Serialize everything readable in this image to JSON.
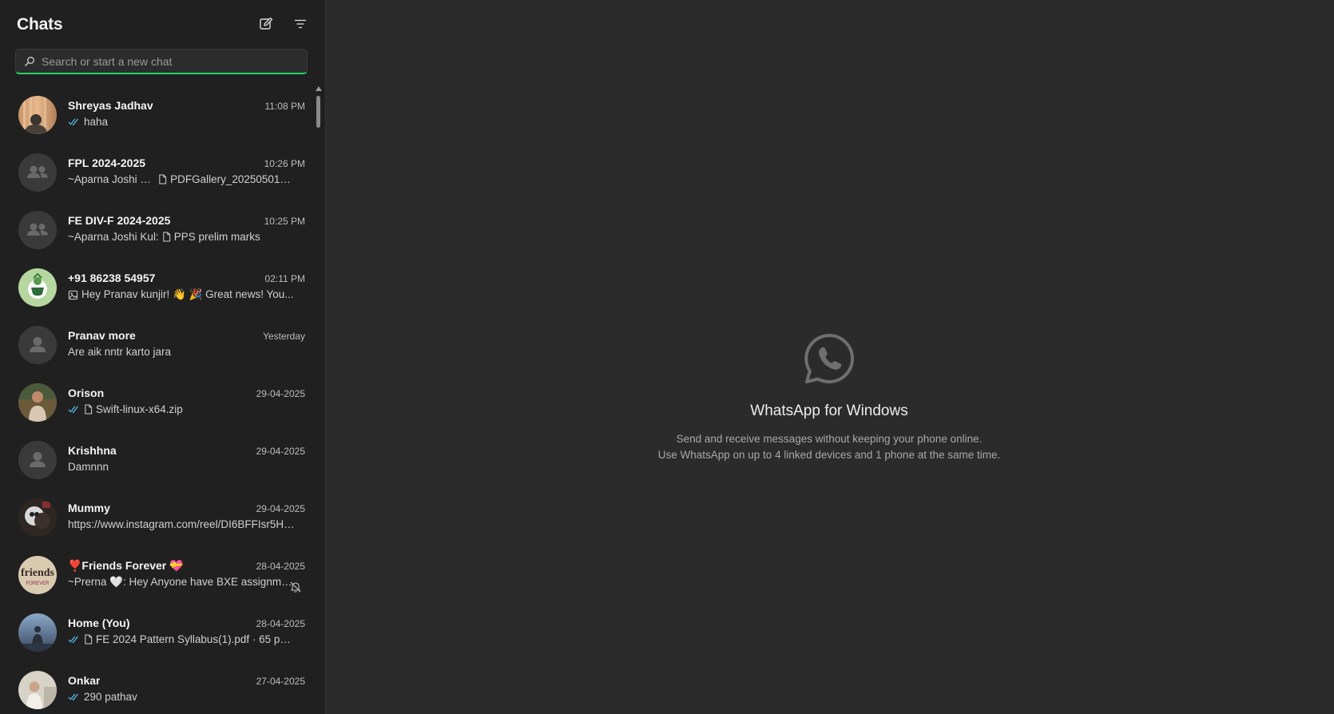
{
  "sidebar": {
    "title": "Chats",
    "search_placeholder": "Search or start a new chat"
  },
  "chats": [
    {
      "name": "Shreyas Jadhav",
      "time": "11:08 PM",
      "preview": "haha",
      "ticks": true,
      "doc": false,
      "img": false,
      "avatar": "photo-warm"
    },
    {
      "name": "FPL 2024-2025",
      "time": "10:26 PM",
      "preview": "~Aparna Joshi Kul: ",
      "doc_name": "PDFGallery_20250501_2...",
      "doc": true,
      "avatar": "group"
    },
    {
      "name": "FE DIV-F  2024-2025",
      "time": "10:25 PM",
      "preview": "~Aparna Joshi Kul: ",
      "doc_name": "PPS prelim marks",
      "doc": true,
      "avatar": "group"
    },
    {
      "name": "+91 86238 54957",
      "time": "02:11 PM",
      "preview": "Hey Pranav kunjir! 👋  🎉 Great news! You...",
      "img": true,
      "avatar": "photo-green"
    },
    {
      "name": "Pranav more",
      "time": "Yesterday",
      "preview": "Are aik nntr karto jara",
      "avatar": "person"
    },
    {
      "name": "Orison",
      "time": "29-04-2025",
      "preview": "",
      "doc_name": "Swift-linux-x64.zip",
      "ticks": true,
      "doc": true,
      "avatar": "photo-person"
    },
    {
      "name": "Krishhna",
      "time": "29-04-2025",
      "preview": "Damnnn",
      "avatar": "person"
    },
    {
      "name": "Mummy",
      "time": "29-04-2025",
      "preview": "https://www.instagram.com/reel/DI6BFFIsr5H/?...",
      "avatar": "photo-dark"
    },
    {
      "name": "❣️Friends Forever 💝",
      "time": "28-04-2025",
      "preview": "~Prerna 🤍: Hey Anyone have BXE assignme...",
      "muted": true,
      "avatar": "photo-friends"
    },
    {
      "name": "Home (You)",
      "time": "28-04-2025",
      "preview": "",
      "doc_name": "FE 2024 Pattern Syllabus(1).pdf · 65 pages",
      "ticks": true,
      "doc": true,
      "avatar": "photo-blue"
    },
    {
      "name": "Onkar",
      "time": "27-04-2025",
      "preview": "290 pathav",
      "ticks": true,
      "avatar": "photo-light"
    }
  ],
  "welcome": {
    "title": "WhatsApp for Windows",
    "line1": "Send and receive messages without keeping your phone online.",
    "line2": "Use WhatsApp on up to 4 linked devices and 1 phone at the same time."
  },
  "colors": {
    "accent": "#25d366",
    "tick_blue": "#53bdeb",
    "sidebar_bg": "#202020",
    "main_bg": "#2b2b2b"
  }
}
